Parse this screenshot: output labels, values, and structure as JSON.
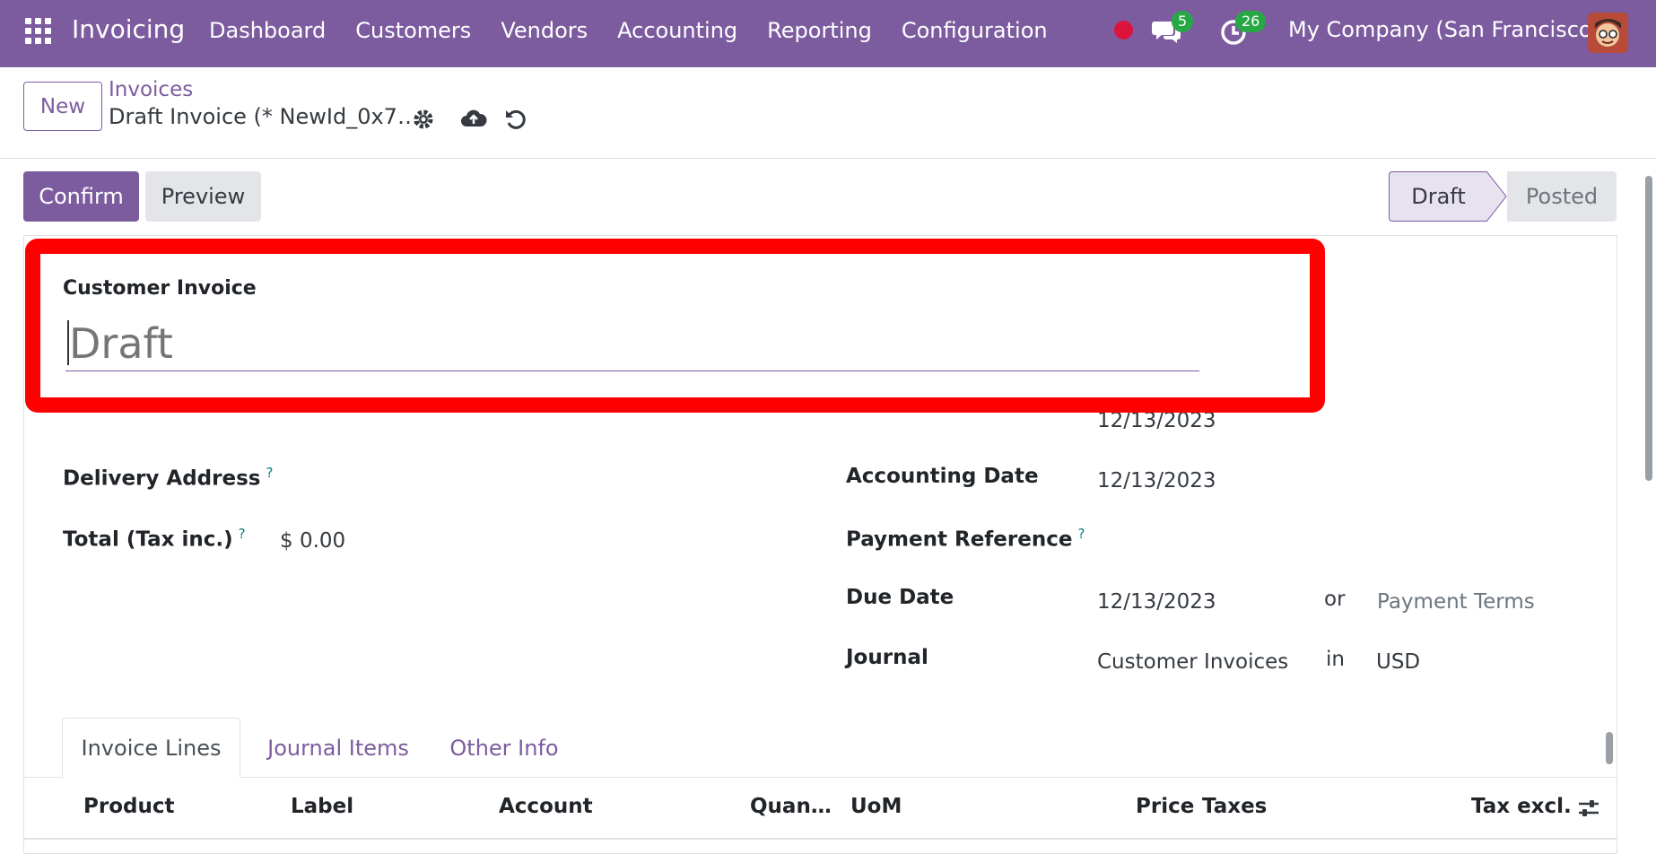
{
  "navbar": {
    "app_name": "Invoicing",
    "menu": [
      "Dashboard",
      "Customers",
      "Vendors",
      "Accounting",
      "Reporting",
      "Configuration"
    ],
    "messages_count": "5",
    "activities_count": "26",
    "company": "My Company (San Francisco)"
  },
  "control_panel": {
    "new_label": "New",
    "breadcrumb_parent": "Invoices",
    "breadcrumb_current": "Draft Invoice (* NewId_0x7…"
  },
  "status_bar": {
    "confirm_label": "Confirm",
    "preview_label": "Preview",
    "stages": [
      "Draft",
      "Posted"
    ],
    "current_stage": "Draft"
  },
  "form": {
    "document_type": "Customer Invoice",
    "name_placeholder": "Draft",
    "fields_left": {
      "delivery_address_label": "Delivery Address",
      "delivery_address_help": "?",
      "total_label": "Total (Tax inc.)",
      "total_help": "?",
      "total_value": "$ 0.00"
    },
    "fields_right": {
      "invoice_date_value": "12/13/2023",
      "accounting_date_label": "Accounting Date",
      "accounting_date_value": "12/13/2023",
      "payment_reference_label": "Payment Reference",
      "payment_reference_help": "?",
      "due_date_label": "Due Date",
      "due_date_value": "12/13/2023",
      "or_text": "or",
      "payment_terms_placeholder": "Payment Terms",
      "journal_label": "Journal",
      "journal_value": "Customer Invoices",
      "in_text": "in",
      "currency_value": "USD"
    }
  },
  "tabs": [
    "Invoice Lines",
    "Journal Items",
    "Other Info"
  ],
  "table_headers": [
    "Product",
    "Label",
    "Account",
    "Quan…",
    "UoM",
    "Price",
    "Taxes",
    "Tax excl."
  ],
  "colors": {
    "brand": "#7c5c9f",
    "highlight": "#ff0000",
    "badge": "#28a745",
    "recording": "#dc143c"
  }
}
